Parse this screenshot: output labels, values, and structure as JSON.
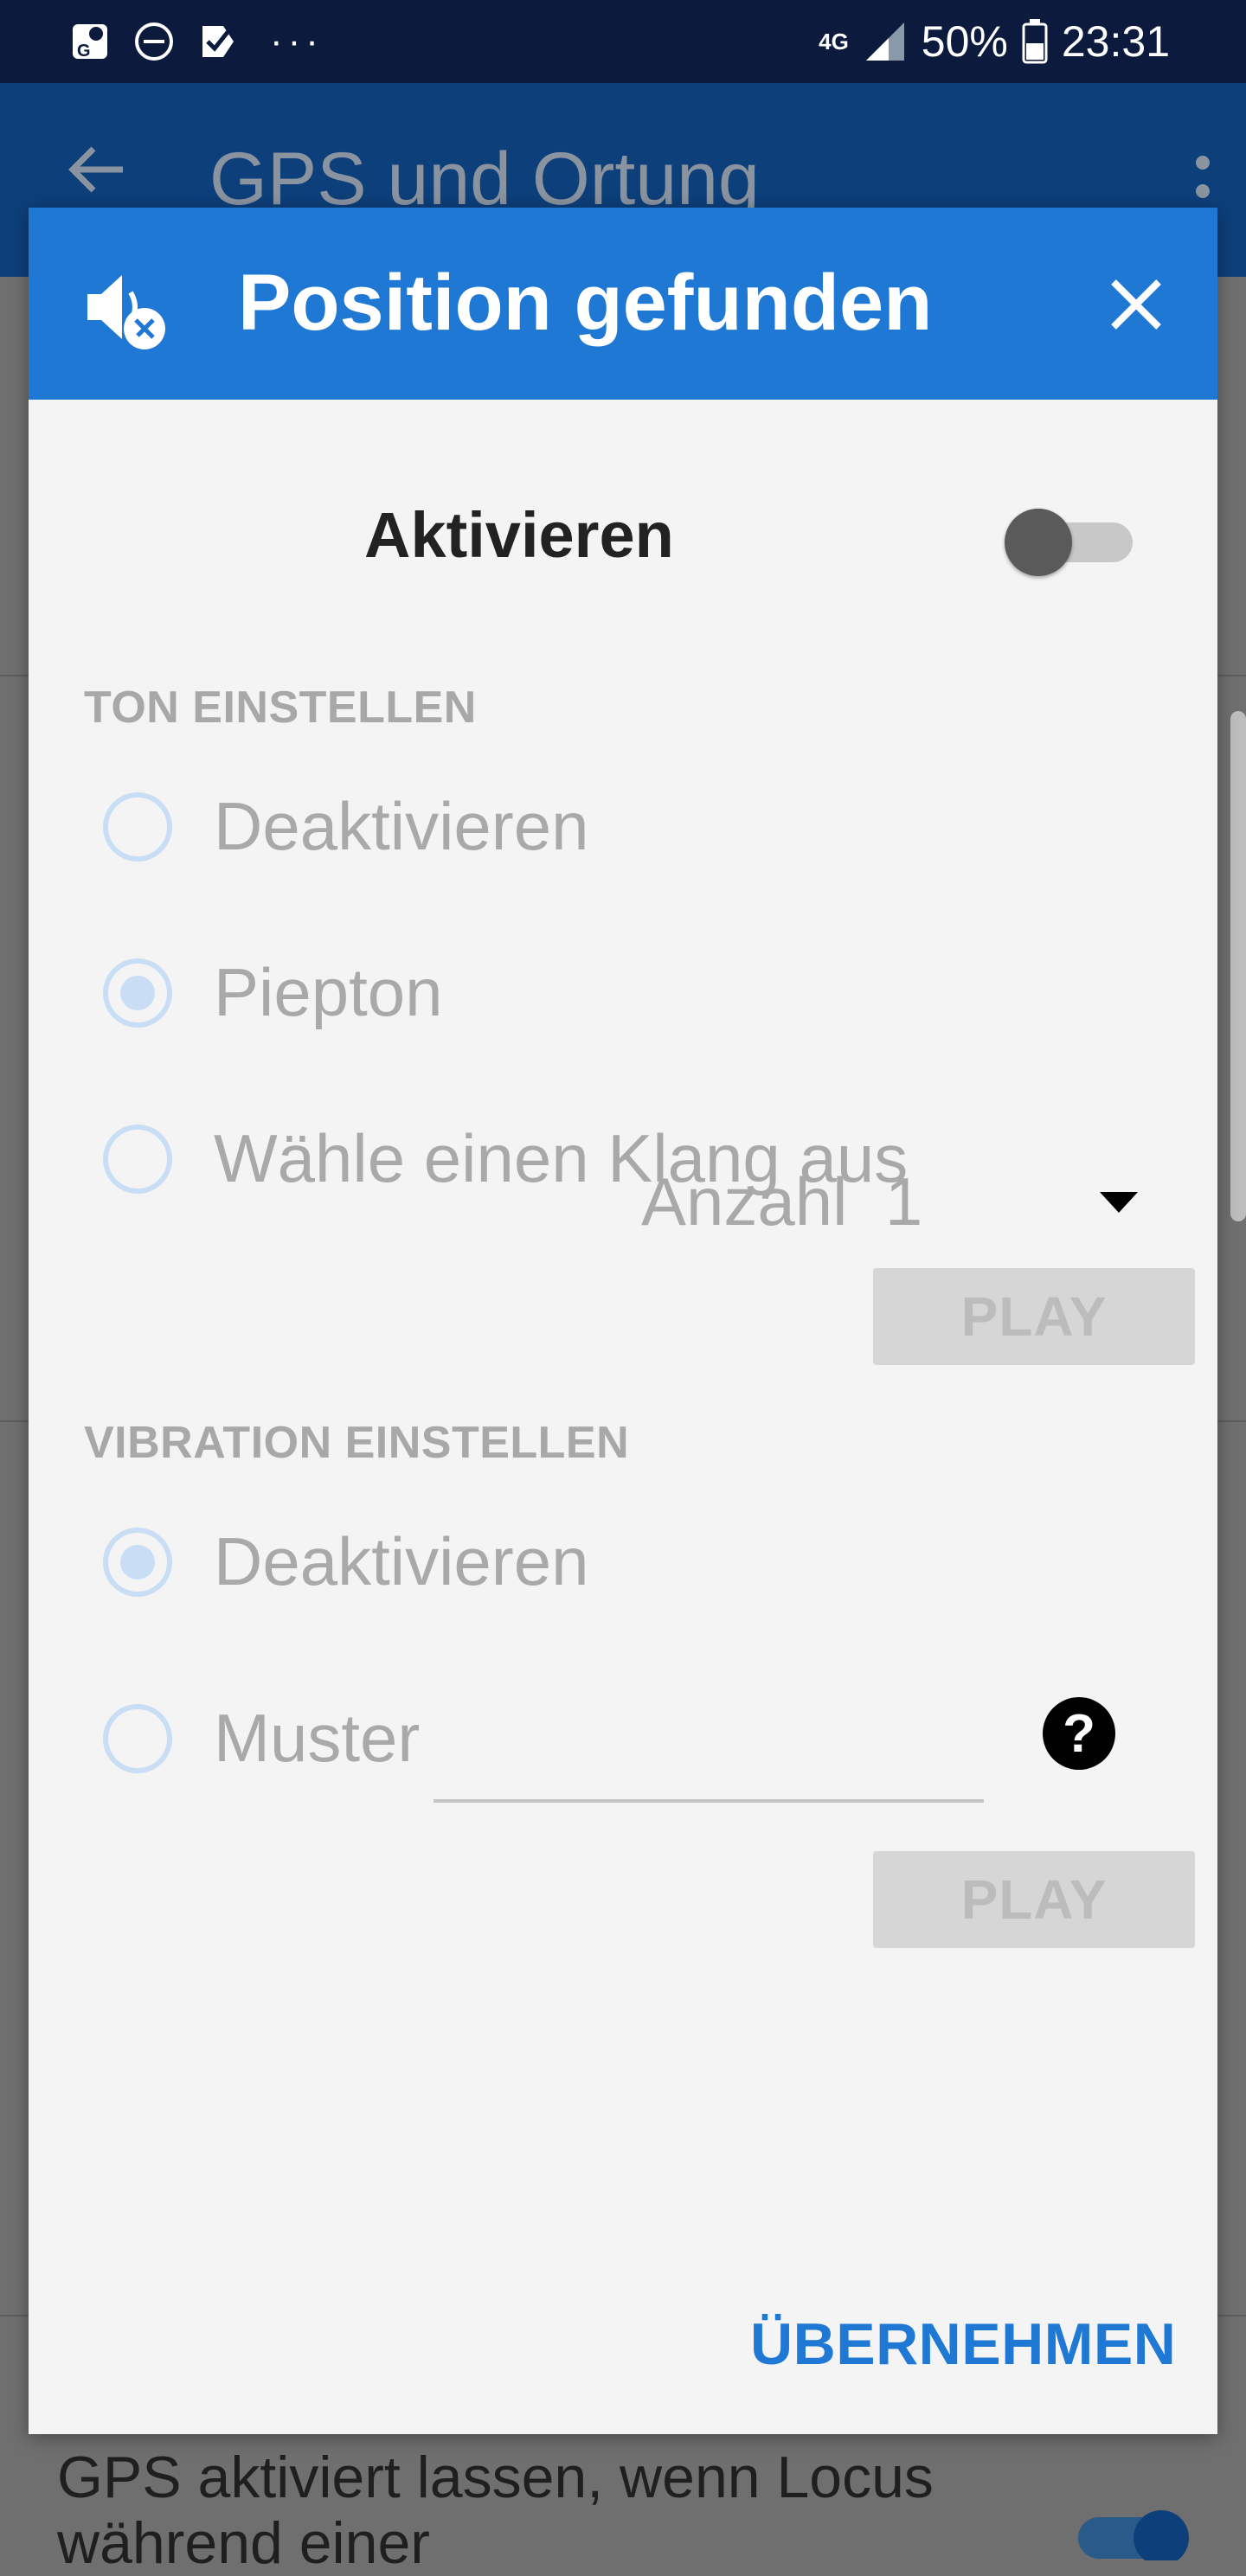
{
  "status_bar": {
    "network": "4G",
    "battery": "50%",
    "time": "23:31",
    "left_icons": [
      "maps-icon",
      "dnd-icon",
      "check-icon"
    ],
    "more": "···"
  },
  "app_bar": {
    "title": "GPS und Ortung"
  },
  "dialog": {
    "title": "Position gefunden",
    "activate_label": "Aktivieren",
    "activate_on": false,
    "sound": {
      "section_title": "TON EINSTELLEN",
      "options": [
        "Deaktivieren",
        "Piepton",
        "Wähle einen Klang aus"
      ],
      "selected": "Piepton",
      "count_label": "Anzahl",
      "count_value": "1",
      "play_label": "PLAY"
    },
    "vibration": {
      "section_title": "VIBRATION EINSTELLEN",
      "options": [
        "Deaktivieren",
        "Muster"
      ],
      "selected": "Deaktivieren",
      "pattern_value": "",
      "help": "?",
      "play_label": "PLAY"
    },
    "apply_label": "ÜBERNEHMEN"
  },
  "background": {
    "setting_text": "GPS aktiviert lassen, wenn Locus während einer"
  },
  "colors": {
    "accent": "#1e78d4",
    "status_bar": "#0b1a3d",
    "disabled_text": "#a9a9a9"
  }
}
